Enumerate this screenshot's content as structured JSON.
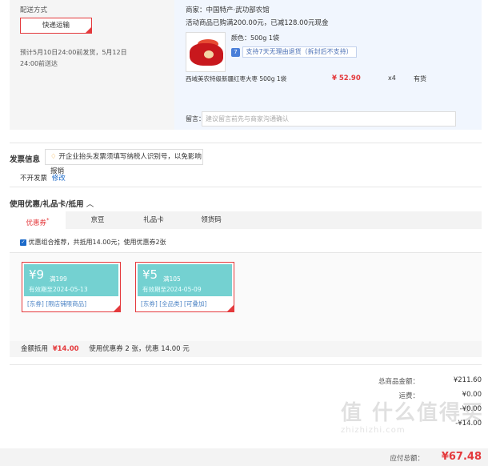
{
  "delivery": {
    "title": "配送方式",
    "method": "快递运输",
    "estimate_line1": "预计5月10日24:00前发货，5月12日",
    "estimate_line2": "24:00前送达"
  },
  "shop": {
    "merchant": "商家：中国特产·武功部农馆",
    "promo": "活动商品已购满200.00元，已减128.00元现金",
    "spec": "颜色：500g 1袋",
    "return_tag": "7",
    "return_text": "支持7天无理由退货（拆封后不支持）",
    "product_name": "西域美农特级新疆红枣大枣 500g 1袋",
    "price": "¥ 52.90",
    "qty": "x4",
    "stock": "有货",
    "remark_label": "留言：",
    "remark_placeholder": "建议留言前先与商家沟通确认"
  },
  "invoice": {
    "title": "发票信息",
    "tip": "开企业抬头发票须填写纳税人识别号，以免影响报销",
    "status": "不开发票",
    "modify": "修改"
  },
  "discount": {
    "title": "使用优惠/礼品卡/抵用",
    "tabs": [
      {
        "label": "优惠券",
        "mark": "*"
      },
      {
        "label": "京豆"
      },
      {
        "label": "礼品卡"
      },
      {
        "label": "领货码"
      }
    ],
    "combo_text": "优惠组合推荐，共抵用14.00元；使用优惠券2张",
    "coupons": [
      {
        "amount": "¥9",
        "cond": "满199",
        "expire": "有效期至2024-05-13",
        "tags": [
          "[东券]",
          "[限店铺限商品]"
        ]
      },
      {
        "amount": "¥5",
        "cond": "满105",
        "expire": "有效期至2024-05-09",
        "tags": [
          "[东券]",
          "[全品类]",
          "[可叠加]"
        ]
      }
    ],
    "summary_label": "金额抵用",
    "summary_amount": "¥14.00",
    "summary_desc": "使用优惠券 2 张，优惠 14.00 元"
  },
  "totals": {
    "rows": [
      {
        "label": "总商品金额：",
        "value": "¥211.60"
      },
      {
        "label": "运费：",
        "value": "¥0.00"
      },
      {
        "label": "",
        "value": "-¥0.00"
      },
      {
        "label": "",
        "value": "-¥14.00"
      }
    ],
    "payable_label": "应付总额：",
    "payable_value": "¥67.48"
  },
  "watermark": "值 什么值得买",
  "watermark_url": "zhizhizhi.com"
}
